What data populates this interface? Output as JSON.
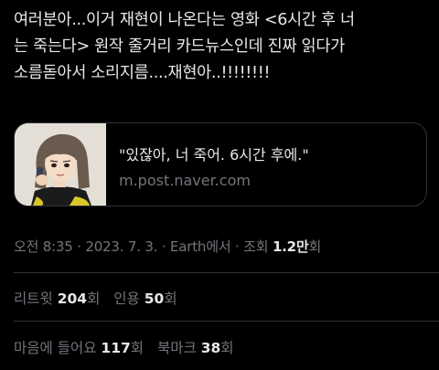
{
  "tweet": {
    "text": "여러분아...이거 재현이 나온다는 영화 <6시간 후 너\n는 죽는다> 원작 줄거리 카드뉴스인데 진짜 읽다가\n소름돋아서 소리지름....재현아..!!!!!!!!"
  },
  "link_card": {
    "title": "\"있잖아, 너 죽어. 6시간 후에.\"",
    "domain": "m.post.naver.com"
  },
  "meta": {
    "time": "오전 8:35",
    "sep1": " · ",
    "date": "2023. 7. 3.",
    "sep2": " · ",
    "source": "Earth에서",
    "sep3": " · ",
    "views_label": "조회 ",
    "views_value": "1.2만",
    "views_unit": "회"
  },
  "stats_row1": {
    "retweets_label": "리트윗 ",
    "retweets_value": "204",
    "retweets_unit": "회",
    "quotes_label": "인용 ",
    "quotes_value": "50",
    "quotes_unit": "회"
  },
  "stats_row2": {
    "likes_label": "마음에 들어요 ",
    "likes_value": "117",
    "likes_unit": "회",
    "bookmarks_label": "북마크 ",
    "bookmarks_value": "38",
    "bookmarks_unit": "회"
  },
  "colors": {
    "background": "#000000",
    "text": "#e7e9ea",
    "muted": "#71767b",
    "border": "#2f3336"
  }
}
